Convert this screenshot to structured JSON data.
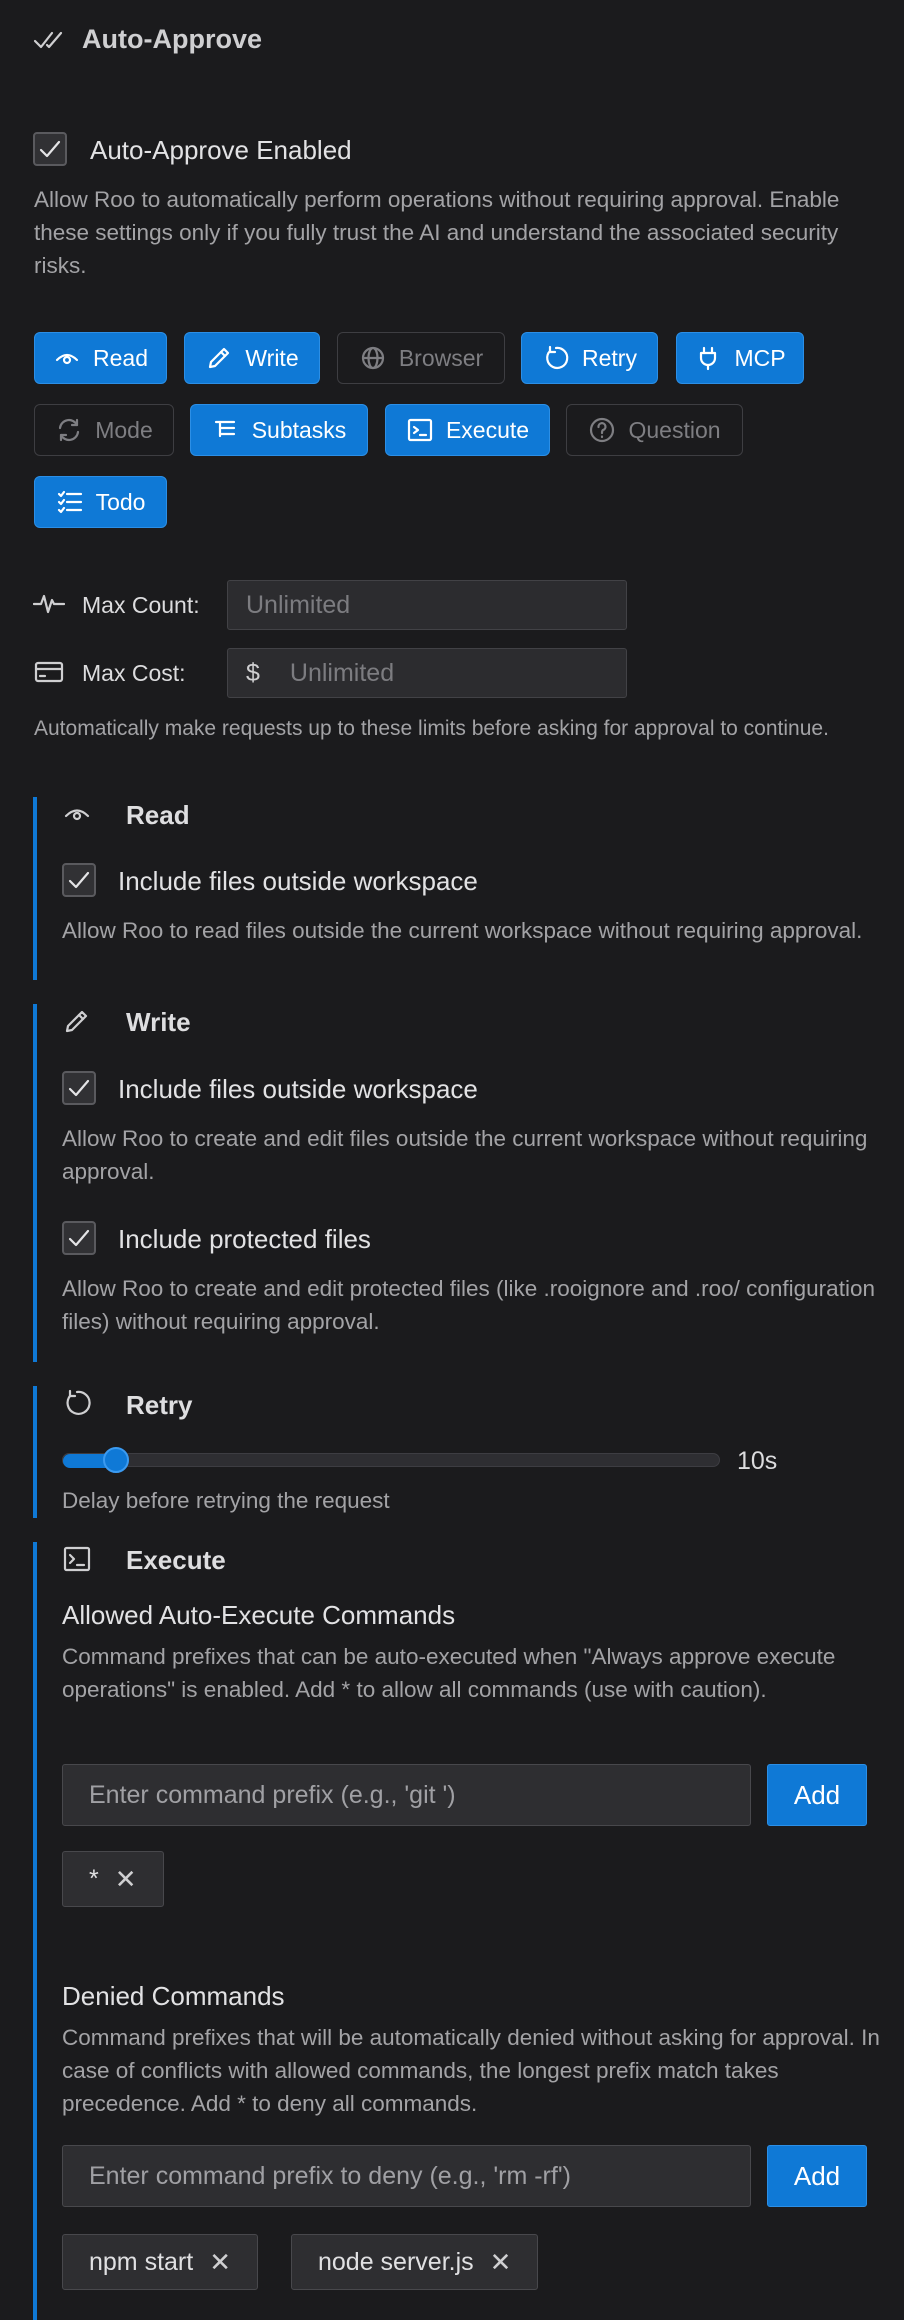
{
  "header": {
    "title": "Auto-Approve",
    "icon": "check-check-icon"
  },
  "enabled": {
    "label": "Auto-Approve Enabled",
    "checked": true,
    "description": "Allow Roo to automatically perform operations without requiring approval. Enable these settings only if you fully trust the AI and understand the associated security risks."
  },
  "toggles": [
    {
      "label": "Read",
      "icon": "eye-icon",
      "on": true
    },
    {
      "label": "Write",
      "icon": "pencil-icon",
      "on": true
    },
    {
      "label": "Browser",
      "icon": "globe-icon",
      "on": false
    },
    {
      "label": "Retry",
      "icon": "refresh-icon",
      "on": true
    },
    {
      "label": "MCP",
      "icon": "plug-icon",
      "on": true
    },
    {
      "label": "Mode",
      "icon": "sync-icon",
      "on": false
    },
    {
      "label": "Subtasks",
      "icon": "list-tree-icon",
      "on": true
    },
    {
      "label": "Execute",
      "icon": "terminal-icon",
      "on": true
    },
    {
      "label": "Question",
      "icon": "question-icon",
      "on": false
    },
    {
      "label": "Todo",
      "icon": "checklist-icon",
      "on": true
    }
  ],
  "limits": {
    "max_count_label": "Max Count:",
    "max_count_placeholder": "Unlimited",
    "max_cost_label": "Max Cost:",
    "max_cost_prefix": "$",
    "max_cost_placeholder": "Unlimited",
    "description": "Automatically make requests up to these limits before asking for approval to continue."
  },
  "read": {
    "title": "Read",
    "option_label": "Include files outside workspace",
    "option_checked": true,
    "option_description": "Allow Roo to read files outside the current workspace without requiring approval."
  },
  "write": {
    "title": "Write",
    "outside_label": "Include files outside workspace",
    "outside_checked": true,
    "outside_description": "Allow Roo to create and edit files outside the current workspace without requiring approval.",
    "protected_label": "Include protected files",
    "protected_checked": true,
    "protected_description": "Allow Roo to create and edit protected files (like .rooignore and .roo/ configuration files) without requiring approval."
  },
  "retry": {
    "title": "Retry",
    "value_label": "10s",
    "slider_fraction": 0.07,
    "description": "Delay before retrying the request"
  },
  "execute": {
    "title": "Execute",
    "allowed_title": "Allowed Auto-Execute Commands",
    "allowed_description": "Command prefixes that can be auto-executed when \"Always approve execute operations\" is enabled. Add * to allow all commands (use with caution).",
    "allowed_placeholder": "Enter command prefix (e.g., 'git ')",
    "add_label": "Add",
    "allowed_commands": [
      "*"
    ],
    "denied_title": "Denied Commands",
    "denied_description": "Command prefixes that will be automatically denied without asking for approval. In case of conflicts with allowed commands, the longest prefix match takes precedence. Add * to deny all commands.",
    "denied_placeholder": "Enter command prefix to deny (e.g., 'rm -rf')",
    "denied_add_label": "Add",
    "denied_commands": [
      "npm start",
      "node server.js"
    ]
  },
  "colors": {
    "accent": "#0f79d6",
    "background": "#1b1b1d"
  }
}
